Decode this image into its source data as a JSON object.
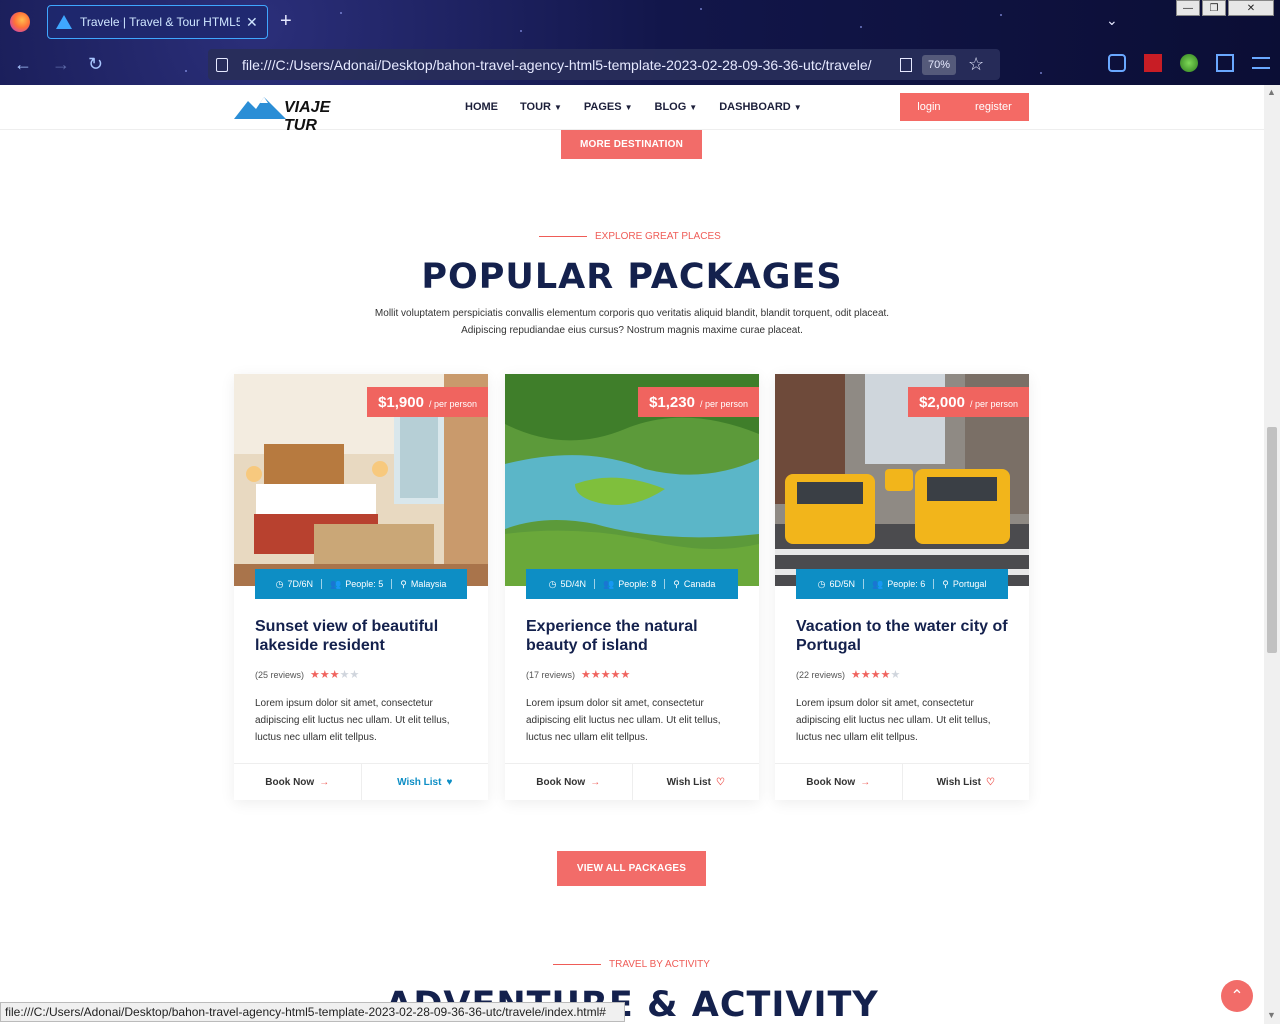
{
  "browser": {
    "tab_title": "Travele | Travel & Tour HTML5",
    "url": "file:///C:/Users/Adonai/Desktop/bahon-travel-agency-html5-template-2023-02-28-09-36-36-utc/travele/",
    "zoom": "70%",
    "status_url": "file:///C:/Users/Adonai/Desktop/bahon-travel-agency-html5-template-2023-02-28-09-36-36-utc/travele/index.html#"
  },
  "header": {
    "logo_text": "VIAJE TUR",
    "nav": [
      "HOME",
      "TOUR",
      "PAGES",
      "BLOG",
      "DASHBOARD"
    ],
    "login": "login",
    "register": "register"
  },
  "section_prev": {
    "button": "MORE DESTINATION"
  },
  "section": {
    "eyebrow": "EXPLORE GREAT PLACES",
    "title": "POPULAR PACKAGES",
    "intro": "Mollit voluptatem perspiciatis convallis elementum corporis quo veritatis aliquid blandit, blandit torquent, odit placeat. Adipiscing repudiandae eius cursus? Nostrum magnis maxime curae placeat.",
    "view_all": "VIEW ALL PACKAGES"
  },
  "packages": [
    {
      "price": "$1,900",
      "per": "/ per person",
      "duration": "7D/6N",
      "people": "People: 5",
      "location": "Malaysia",
      "title": "Sunset view of beautiful lakeside resident",
      "reviews": "(25 reviews)",
      "rating": 3,
      "desc": "Lorem ipsum dolor sit amet, consectetur adipiscing elit luctus nec ullam. Ut elit tellus, luctus nec ullam elit tellpus.",
      "book": "Book Now",
      "wish": "Wish List"
    },
    {
      "price": "$1,230",
      "per": "/ per person",
      "duration": "5D/4N",
      "people": "People: 8",
      "location": "Canada",
      "title": "Experience the natural beauty of island",
      "reviews": "(17 reviews)",
      "rating": 5,
      "desc": "Lorem ipsum dolor sit amet, consectetur adipiscing elit luctus nec ullam. Ut elit tellus, luctus nec ullam elit tellpus.",
      "book": "Book Now",
      "wish": "Wish List"
    },
    {
      "price": "$2,000",
      "per": "/ per person",
      "duration": "6D/5N",
      "people": "People: 6",
      "location": "Portugal",
      "title": "Vacation to the water city of Portugal",
      "reviews": "(22 reviews)",
      "rating": 4,
      "desc": "Lorem ipsum dolor sit amet, consectetur adipiscing elit luctus nec ullam. Ut elit tellus, luctus nec ullam elit tellpus.",
      "book": "Book Now",
      "wish": "Wish List"
    }
  ],
  "next_section": {
    "eyebrow": "TRAVEL BY ACTIVITY",
    "title": "ADVENTURE & ACTIVITY"
  },
  "colors": {
    "accent": "#f26c69",
    "navy": "#14214d",
    "blue": "#0d8ec5"
  }
}
